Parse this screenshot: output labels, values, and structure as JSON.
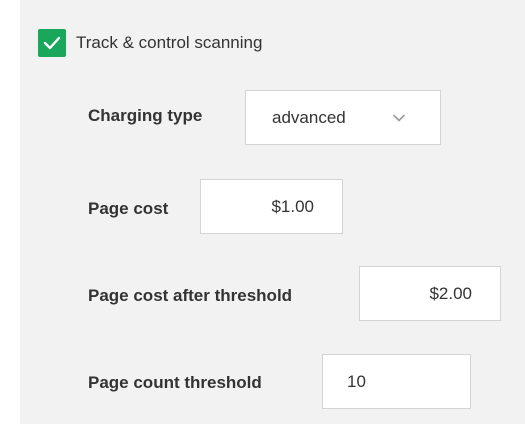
{
  "scanning": {
    "checkbox_label": "Track & control scanning",
    "checked": true
  },
  "fields": {
    "charging_type": {
      "label": "Charging type",
      "value": "advanced"
    },
    "page_cost": {
      "label": "Page cost",
      "value": "$1.00"
    },
    "page_cost_after_threshold": {
      "label": "Page cost after threshold",
      "value": "$2.00"
    },
    "page_count_threshold": {
      "label": "Page count threshold",
      "value": "10"
    }
  },
  "colors": {
    "panel_background": "#f2f2f2",
    "checkbox_accent": "#19a85b",
    "field_border": "#d4d4d4",
    "text": "#333333"
  }
}
